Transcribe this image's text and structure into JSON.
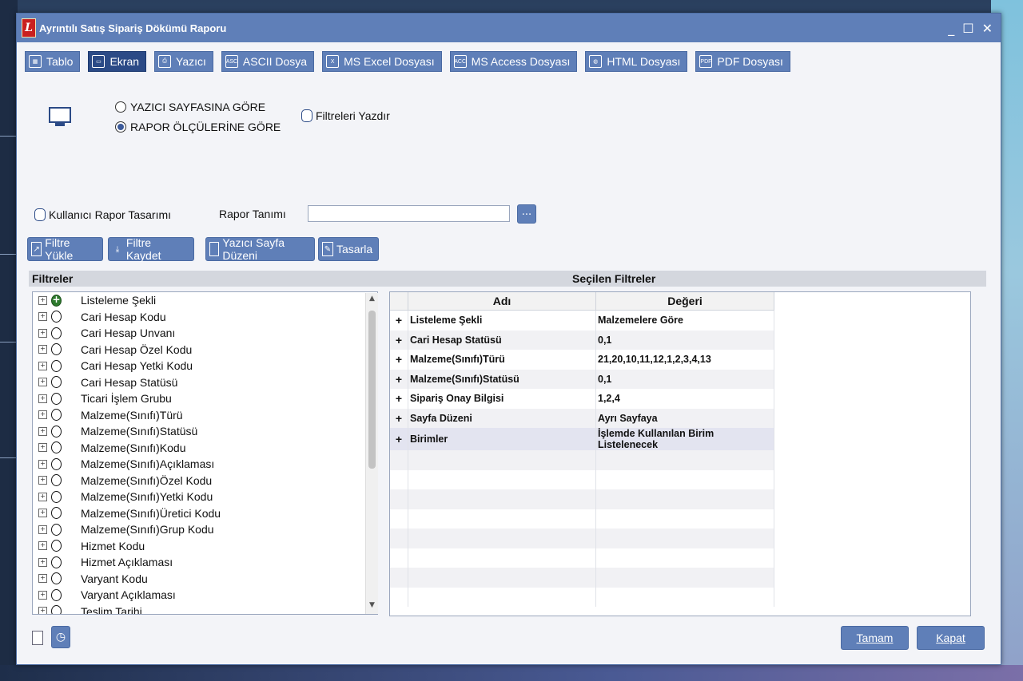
{
  "window": {
    "title": "Ayrıntılı Satış Sipariş Dökümü Raporu",
    "logo_letter": "L"
  },
  "output_tabs": [
    {
      "label": "Tablo",
      "icon": "table-icon"
    },
    {
      "label": "Ekran",
      "icon": "monitor-icon",
      "selected": true
    },
    {
      "label": "Yazıcı",
      "icon": "printer-icon"
    },
    {
      "label": "ASCII Dosya",
      "icon": "ascii-file-icon"
    },
    {
      "label": "MS Excel Dosyası",
      "icon": "excel-file-icon"
    },
    {
      "label": "MS Access Dosyası",
      "icon": "access-file-icon"
    },
    {
      "label": "HTML Dosyası",
      "icon": "html-globe-icon"
    },
    {
      "label": "PDF Dosyası",
      "icon": "pdf-file-icon"
    }
  ],
  "screen_options": {
    "radio_printer_page": "YAZICI SAYFASINA GÖRE",
    "radio_report_size": "RAPOR ÖLÇÜLERİNE GÖRE",
    "print_filters": "Filtreleri Yazdır"
  },
  "design": {
    "user_design": "Kullanıcı Rapor Tasarımı",
    "report_def_label": "Rapor Tanımı",
    "report_def_value": "",
    "browse": "..."
  },
  "actions": {
    "load_filter": "Filtre Yükle",
    "save_filter": "Filtre Kaydet",
    "page_setup": "Yazıcı Sayfa Düzeni",
    "design": "Tasarla"
  },
  "filters_panel": {
    "header": "Filtreler",
    "items": [
      "Listeleme Şekli",
      "Cari Hesap Kodu",
      "Cari Hesap Unvanı",
      "Cari Hesap Özel Kodu",
      "Cari Hesap Yetki Kodu",
      "Cari Hesap Statüsü",
      "Ticari İşlem Grubu",
      "Malzeme(Sınıfı)Türü",
      "Malzeme(Sınıfı)Statüsü",
      "Malzeme(Sınıfı)Kodu",
      "Malzeme(Sınıfı)Açıklaması",
      "Malzeme(Sınıfı)Özel Kodu",
      "Malzeme(Sınıfı)Yetki Kodu",
      "Malzeme(Sınıfı)Üretici Kodu",
      "Malzeme(Sınıfı)Grup Kodu",
      "Hizmet Kodu",
      "Hizmet Açıklaması",
      "Varyant Kodu",
      "Varyant Açıklaması",
      "Teslim Tarihi"
    ]
  },
  "selected_panel": {
    "header": "Seçilen Filtreler",
    "col_name": "Adı",
    "col_value": "Değeri",
    "rows": [
      {
        "name": "Listeleme Şekli",
        "value": "Malzemelere Göre"
      },
      {
        "name": "Cari Hesap Statüsü",
        "value": "0,1"
      },
      {
        "name": "Malzeme(Sınıfı)Türü",
        "value": "21,20,10,11,12,1,2,3,4,13"
      },
      {
        "name": "Malzeme(Sınıfı)Statüsü",
        "value": "0,1"
      },
      {
        "name": "Sipariş Onay Bilgisi",
        "value": "1,2,4"
      },
      {
        "name": "Sayfa Düzeni",
        "value": "Ayrı Sayfaya"
      },
      {
        "name": "Birimler",
        "value": "İşlemde Kullanılan Birim Listelenecek"
      }
    ]
  },
  "footer": {
    "ok": "Tamam",
    "close": "Kapat"
  }
}
